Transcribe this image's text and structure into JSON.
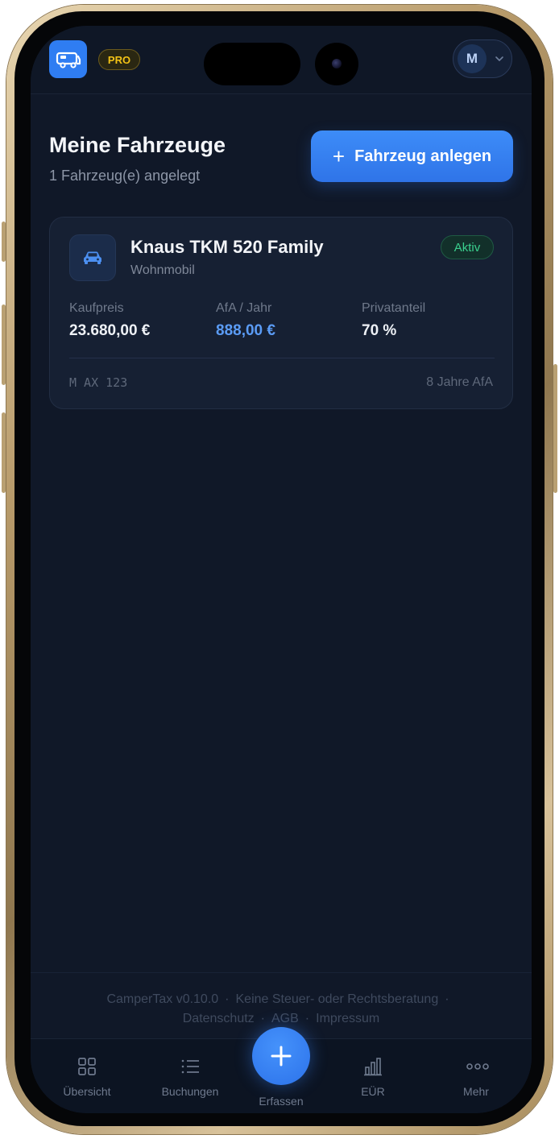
{
  "header": {
    "logo_icon": "camper-van-icon",
    "pro_badge": "PRO",
    "user_initial": "M"
  },
  "page": {
    "title": "Meine Fahrzeuge",
    "subtitle": "1 Fahrzeug(e) angelegt",
    "add_button": "Fahrzeug anlegen"
  },
  "vehicle": {
    "name": "Knaus TKM 520 Family",
    "type": "Wohnmobil",
    "status": "Aktiv",
    "stats": [
      {
        "label": "Kaufpreis",
        "value": "23.680,00 €"
      },
      {
        "label": "AfA / Jahr",
        "value": "888,00 €"
      },
      {
        "label": "Privatanteil",
        "value": "70 %"
      }
    ],
    "plate": "M AX 123",
    "afa_years": "8 Jahre AfA"
  },
  "footer": {
    "version": "CamperTax v0.10.0",
    "disclaimer": "Keine Steuer- oder Rechtsberatung",
    "links": [
      "Datenschutz",
      "AGB",
      "Impressum"
    ]
  },
  "tabbar": {
    "items": [
      {
        "label": "Übersicht",
        "icon": "grid-icon"
      },
      {
        "label": "Buchungen",
        "icon": "list-icon"
      },
      {
        "label": "Erfassen",
        "icon": "plus-icon"
      },
      {
        "label": "EÜR",
        "icon": "bar-chart-icon"
      },
      {
        "label": "Mehr",
        "icon": "more-dots-icon"
      }
    ]
  },
  "colors": {
    "background": "#101828",
    "accent": "#2f7df2",
    "success": "#3ad08e",
    "pro": "#f3c316"
  }
}
